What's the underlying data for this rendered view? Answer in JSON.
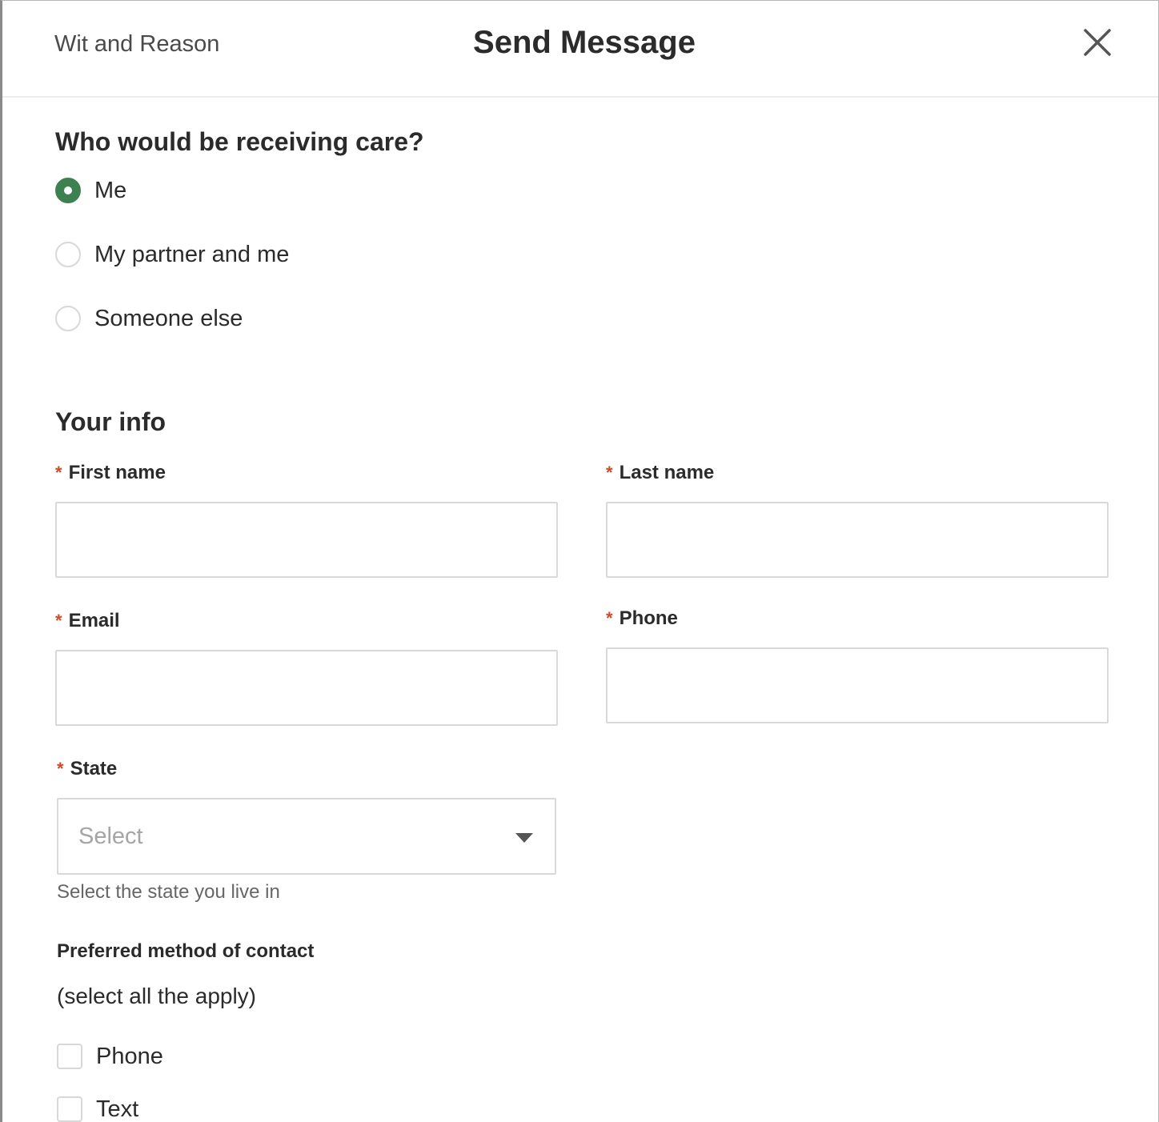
{
  "header": {
    "brand": "Wit and Reason",
    "title": "Send Message",
    "close_icon": "close-icon"
  },
  "care": {
    "question": "Who would be receiving care?",
    "options": [
      {
        "label": "Me",
        "selected": true
      },
      {
        "label": "My partner and me",
        "selected": false
      },
      {
        "label": "Someone else",
        "selected": false
      }
    ]
  },
  "your_info": {
    "heading": "Your info",
    "required_mark": "*",
    "first_name": {
      "label": "First name",
      "value": ""
    },
    "last_name": {
      "label": "Last name",
      "value": ""
    },
    "email": {
      "label": "Email",
      "value": ""
    },
    "phone": {
      "label": "Phone",
      "value": ""
    },
    "state": {
      "label": "State",
      "placeholder": "Select",
      "helper": "Select the state you live in",
      "icon": "caret-down-icon"
    }
  },
  "contact": {
    "label": "Preferred method of contact",
    "sub": "(select all the apply)",
    "options": [
      {
        "label": "Phone",
        "checked": false
      },
      {
        "label": "Text",
        "checked": false
      }
    ]
  },
  "colors": {
    "accent": "#3e8151",
    "required": "#d14b2b",
    "border": "#d9d9d9",
    "placeholder": "#a5a5a5"
  }
}
